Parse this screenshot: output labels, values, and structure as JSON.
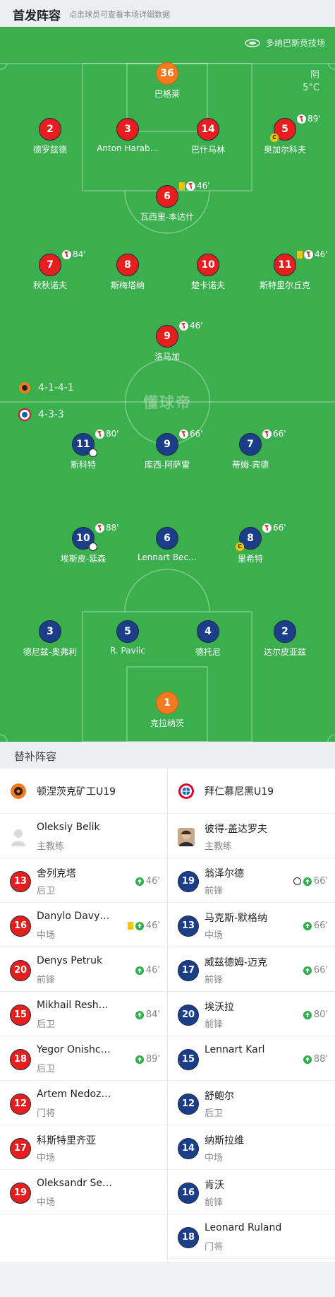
{
  "header": {
    "title": "首发阵容",
    "subtitle": "点击球员可查看本场详细数据"
  },
  "match": {
    "stadium": "多纳巴斯竞技场",
    "weather": "阴",
    "temperature": "5°C",
    "watermark": "懂球帝"
  },
  "home": {
    "formation": "4-1-4-1",
    "players": [
      {
        "number": "36",
        "name": "巴格莱",
        "color": "orange"
      },
      {
        "number": "2",
        "name": "德罗兹德"
      },
      {
        "number": "3",
        "name": "Anton Harab…"
      },
      {
        "number": "14",
        "name": "巴什马林"
      },
      {
        "number": "5",
        "name": "奥加尔科夫",
        "sub_minute": "89'",
        "captain": "C"
      },
      {
        "number": "6",
        "name": "瓦西里-本达什",
        "sub_minute": "46'",
        "yellow": true
      },
      {
        "number": "7",
        "name": "秋秋诺夫",
        "sub_minute": "84'"
      },
      {
        "number": "8",
        "name": "斯梅塔纳"
      },
      {
        "number": "10",
        "name": "楚卡诺夫"
      },
      {
        "number": "11",
        "name": "斯特里尔丘克",
        "sub_minute": "46'",
        "yellow": true
      },
      {
        "number": "9",
        "name": "洛马加",
        "sub_minute": "46'"
      }
    ]
  },
  "away": {
    "formation": "4-3-3",
    "players": [
      {
        "number": "11",
        "name": "斯科特",
        "sub_minute": "80'",
        "goal": true
      },
      {
        "number": "9",
        "name": "库西-阿萨雷",
        "sub_minute": "66'"
      },
      {
        "number": "7",
        "name": "蒂姆-宾德",
        "sub_minute": "66'"
      },
      {
        "number": "10",
        "name": "埃斯皮-延森",
        "sub_minute": "88'",
        "assist": true
      },
      {
        "number": "6",
        "name": "Lennart Bec…"
      },
      {
        "number": "8",
        "name": "里希特",
        "sub_minute": "66'",
        "captain": "C"
      },
      {
        "number": "3",
        "name": "德尼兹-奥弗利"
      },
      {
        "number": "5",
        "name": "R. Pavlic"
      },
      {
        "number": "4",
        "name": "德托尼"
      },
      {
        "number": "2",
        "name": "达尔皮亚兹"
      },
      {
        "number": "1",
        "name": "克拉纳茨",
        "color": "orange"
      }
    ]
  },
  "subs": {
    "title": "替补阵容",
    "home": {
      "team": "顿涅茨克矿工U19",
      "coach_name": "Oleksiy Belik",
      "coach_label": "主教练",
      "players": [
        {
          "number": "13",
          "name": "舍列克塔",
          "position": "后卫",
          "event": "46'"
        },
        {
          "number": "16",
          "name": "Danylo Davy…",
          "position": "中场",
          "event": "46'",
          "yellow": true
        },
        {
          "number": "20",
          "name": "Denys Petruk",
          "position": "前锋",
          "event": "46'"
        },
        {
          "number": "15",
          "name": "Mikhail Resh…",
          "position": "后卫",
          "event": "84'"
        },
        {
          "number": "18",
          "name": "Yegor Onishc…",
          "position": "后卫",
          "event": "89'"
        },
        {
          "number": "12",
          "name": "Artem Nedoz…",
          "position": "门将"
        },
        {
          "number": "17",
          "name": "科斯特里齐亚",
          "position": "中场"
        },
        {
          "number": "19",
          "name": "Oleksandr Se…",
          "position": "中场"
        }
      ]
    },
    "away": {
      "team": "拜仁慕尼黑U19",
      "coach_name": "彼得-盖达罗夫",
      "coach_label": "主教练",
      "players": [
        {
          "number": "19",
          "name": "翁泽尔德",
          "position": "前锋",
          "event": "66'",
          "goal": true
        },
        {
          "number": "13",
          "name": "马克斯-默格纳",
          "position": "中场",
          "event": "66'"
        },
        {
          "number": "17",
          "name": "威兹德姆-迈克",
          "position": "前锋",
          "event": "66'"
        },
        {
          "number": "20",
          "name": "埃沃拉",
          "position": "前锋",
          "event": "80'"
        },
        {
          "number": "15",
          "name": "Lennart Karl",
          "position": "",
          "event": "88'"
        },
        {
          "number": "12",
          "name": "舒鲍尔",
          "position": "后卫"
        },
        {
          "number": "14",
          "name": "纳斯拉维",
          "position": "中场"
        },
        {
          "number": "16",
          "name": "肯沃",
          "position": "前锋"
        },
        {
          "number": "18",
          "name": "Leonard Ruland",
          "position": "门将"
        }
      ]
    }
  }
}
